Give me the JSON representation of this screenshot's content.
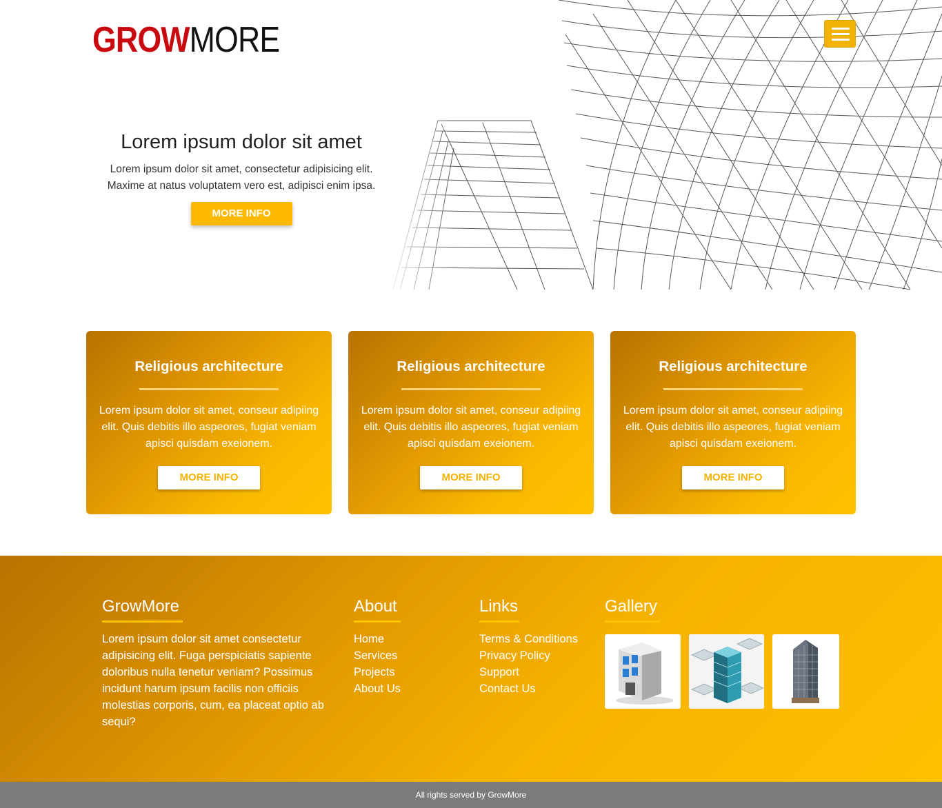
{
  "header": {
    "logo_part1": "GROW",
    "logo_part2": "MORE",
    "menu_icon": "hamburger-menu-icon",
    "accent_color": "#f2b203",
    "logo_red": "#c8090f"
  },
  "hero": {
    "title": "Lorem ipsum dolor sit amet",
    "desc_line1": "Lorem ipsum dolor sit amet, consectetur adipisicing elit.",
    "desc_line2": "Maxime at natus voluptatem vero est, adipisci enim ipsa.",
    "button": "MORE INFO",
    "image": "wireframe-building-sketch"
  },
  "cards": [
    {
      "title": "Religious architecture",
      "text": "Lorem ipsum dolor sit amet, conseur adipiing elit. Quis debitis illo aspeores, fugiat veniam apisci quisdam exeionem.",
      "button": "MORE INFO"
    },
    {
      "title": "Religious architecture",
      "text": "Lorem ipsum dolor sit amet, conseur adipiing elit. Quis debitis illo aspeores, fugiat veniam apisci quisdam exeionem.",
      "button": "MORE INFO"
    },
    {
      "title": "Religious architecture",
      "text": "Lorem ipsum dolor sit amet, conseur adipiing elit. Quis debitis illo aspeores, fugiat veniam apisci quisdam exeionem.",
      "button": "MORE INFO"
    }
  ],
  "footer": {
    "brand_title": "GrowMore",
    "brand_text": "Lorem ipsum dolor sit amet consectetur adipisicing elit. Fuga perspiciatis sapiente doloribus nulla tenetur veniam? Possimus incidunt harum ipsum facilis non officiis molestias corporis, cum, ea placeat optio ab sequi?",
    "about_title": "About",
    "about_links": [
      "Home",
      "Services",
      "Projects",
      "About Us"
    ],
    "links_title": "Links",
    "links": [
      "Terms & Conditions",
      "Privacy Policy",
      "Support",
      "Contact Us"
    ],
    "gallery_title": "Gallery",
    "gallery_images": [
      "office-building-icon",
      "isometric-office-tower-icon",
      "skyscraper-photo"
    ]
  },
  "bottom": {
    "copyright": "All rights served by GrowMore"
  }
}
